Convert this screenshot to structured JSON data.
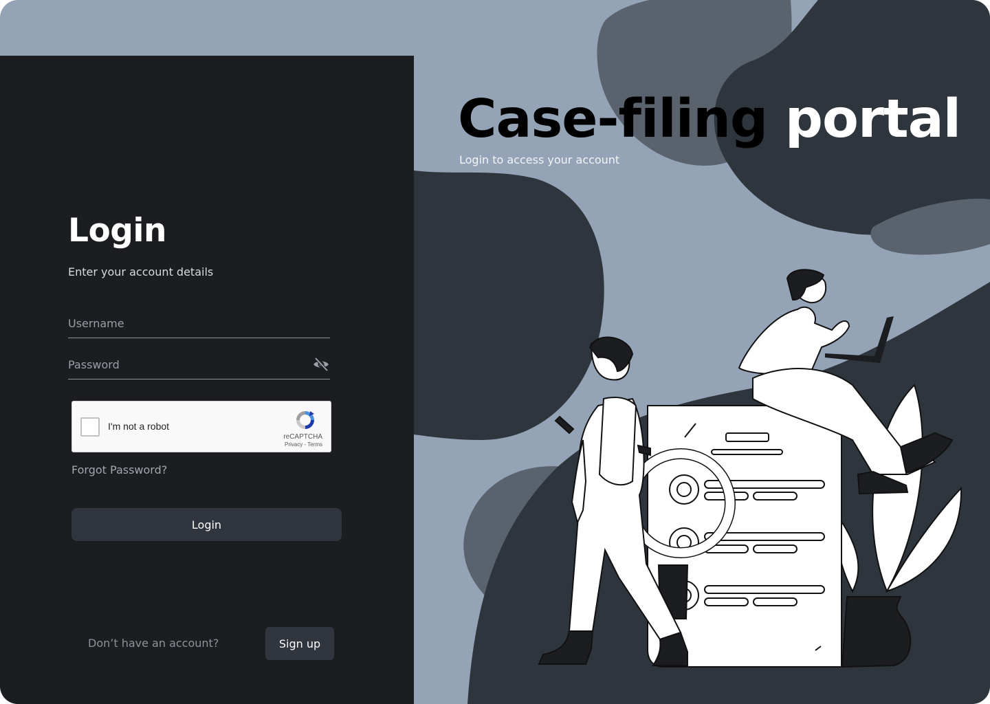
{
  "hero": {
    "title_part1": "Case-filing",
    "title_part2": "portal",
    "subtitle": "Login to access your account"
  },
  "login": {
    "heading": "Login",
    "subheading": "Enter your account details",
    "username_placeholder": "Username",
    "password_placeholder": "Password",
    "password_toggle_icon": "eye-off-icon",
    "forgot_password": "Forgot Password?",
    "submit_label": "Login"
  },
  "recaptcha": {
    "label": "I'm not a robot",
    "brand": "reCAPTCHA",
    "privacy": "Privacy",
    "separator": " - ",
    "terms": "Terms"
  },
  "signup": {
    "prompt": "Don’t have an account?",
    "button_label": "Sign up"
  },
  "colors": {
    "page_background": "#94a3b6",
    "login_panel": "#1c1d21",
    "button": "#31363e",
    "blob_dark": "#2f353d",
    "blob_mid": "#59626d"
  }
}
